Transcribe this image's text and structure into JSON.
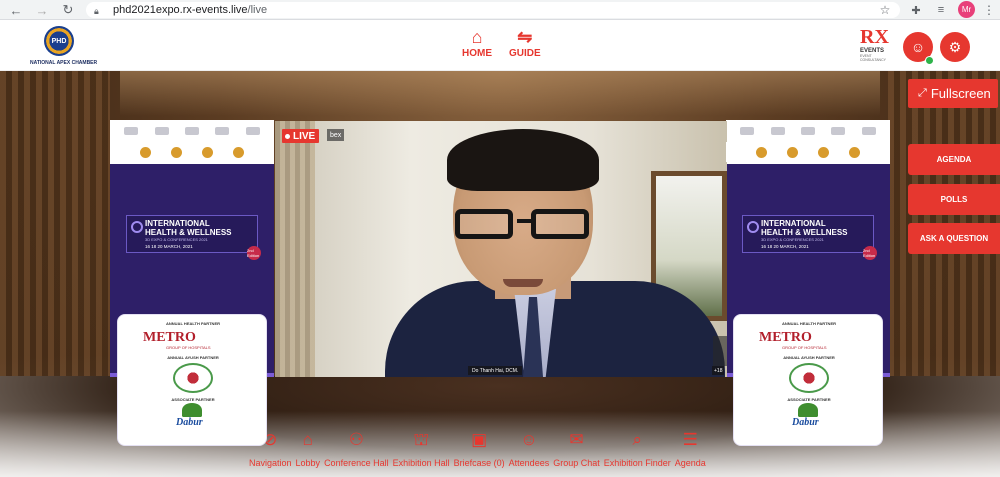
{
  "browser": {
    "url_host": "phd2021expo.rx-events.live",
    "url_path": "/live",
    "profile_initials": "Mr"
  },
  "header": {
    "logo_caption": "NATIONAL APEX CHAMBER",
    "logo_short": "PHD",
    "nav": [
      {
        "label": "HOME",
        "icon": "home-icon"
      },
      {
        "label": "GUIDE",
        "icon": "signpost-icon"
      }
    ],
    "rx_brand": "RX",
    "rx_events": "EVENTS",
    "rx_tagline": "EVENT CONSULTANCY"
  },
  "banner": {
    "title_line1": "INTERNATIONAL",
    "title_line2": "HEALTH & WELLNESS",
    "title_line3": "3D EXPO & CONFERENCES 2021",
    "dates": "16 18 20 MARCH, 2021",
    "edition": "2nd Edition",
    "health_partner_label": "ANNUAL HEALTH PARTNER",
    "health_partner": "METRO",
    "health_partner_sub": "GROUP OF HOSPITALS",
    "ayush_partner_label": "ANNUAL AYUSH PARTNER",
    "associate_partner_label": "ASSOCIATE PARTNER",
    "associate_partner": "Dabur"
  },
  "video": {
    "live_label": "LIVE",
    "webex_label": "bex",
    "speaker_name": "Do Thanh Hai, DCM.",
    "participant_count": "+18"
  },
  "side_buttons": {
    "fullscreen": "Fullscreen",
    "agenda": "AGENDA",
    "polls": "POLLS",
    "ask": "ASK A QUESTION"
  },
  "bottom_nav": [
    {
      "label": "Navigation",
      "icon": "compass-icon",
      "glyph": "⊘"
    },
    {
      "label": "Lobby",
      "icon": "lobby-icon",
      "glyph": "⌂"
    },
    {
      "label": "Conference Hall",
      "icon": "conference-hall-icon",
      "glyph": "⚇"
    },
    {
      "label": "Exhibition Hall",
      "icon": "exhibition-hall-icon",
      "glyph": "⛫"
    },
    {
      "label": "Briefcase (0)",
      "icon": "briefcase-icon",
      "glyph": "▣"
    },
    {
      "label": "Attendees",
      "icon": "attendees-icon",
      "glyph": "☺"
    },
    {
      "label": "Group Chat",
      "icon": "chat-icon",
      "glyph": "✉"
    },
    {
      "label": "Exhibition Finder",
      "icon": "finder-icon",
      "glyph": "⌕"
    },
    {
      "label": "Agenda",
      "icon": "agenda-icon",
      "glyph": "☰"
    }
  ],
  "colors": {
    "accent": "#e6372f",
    "banner_purple": "#2e1f68"
  }
}
